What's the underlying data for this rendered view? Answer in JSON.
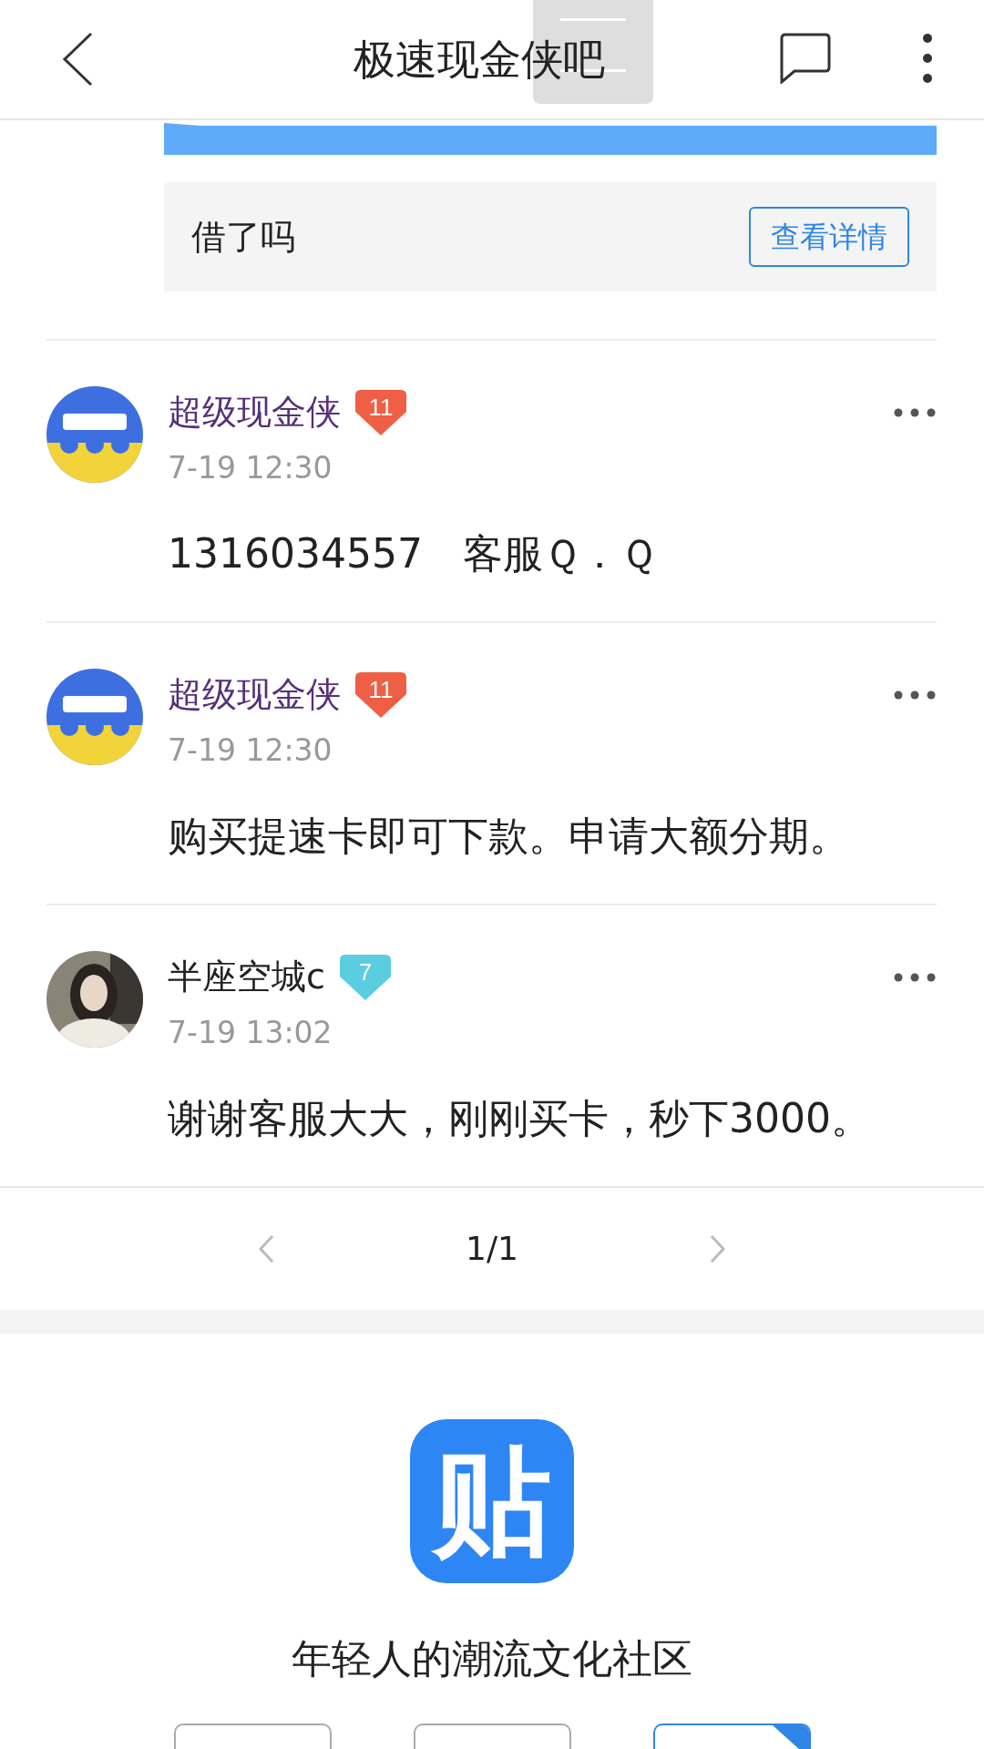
{
  "header": {
    "title": "极速现金侠吧"
  },
  "card": {
    "text": "借了吗",
    "button": "查看详情"
  },
  "posts": [
    {
      "user": "超级现金侠",
      "level": "11",
      "color": "#ef5f45",
      "kind": "logo",
      "time": "7-19 12:30",
      "content": "1316034557　客服Ｑ．Ｑ"
    },
    {
      "user": "超级现金侠",
      "level": "11",
      "color": "#ef5f45",
      "kind": "logo",
      "time": "7-19 12:30",
      "content": "购买提速卡即可下款。申请大额分期。"
    },
    {
      "user": "半座空城c",
      "level": "7",
      "color": "#5bcde0",
      "time": "7-19 13:02",
      "content": "谢谢客服大大，刚刚买卡，秒下3000。"
    }
  ],
  "pagination": {
    "page": "1/1"
  },
  "footer": {
    "logo": "贴",
    "tagline": "年轻人的潮流文化社区"
  }
}
